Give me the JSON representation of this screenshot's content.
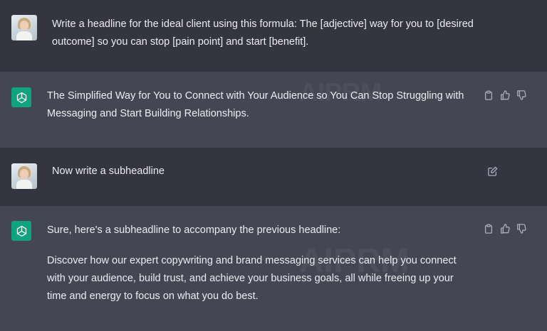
{
  "conversation": [
    {
      "role": "user",
      "avatar_icon": "user-avatar-photo",
      "text_lines": [
        "Write a headline for the ideal client using this formula: The [adjective] way for you to [desired",
        "outcome] so you can stop [pain point] and start [benefit]."
      ]
    },
    {
      "role": "assistant",
      "avatar_icon": "chatgpt-logo-icon",
      "text_lines": [
        "The Simplified Way for You to Connect with Your Audience so You Can Stop Struggling with",
        "Messaging and Start Building Relationships."
      ]
    },
    {
      "role": "user",
      "avatar_icon": "user-avatar-photo",
      "text_lines": [
        "Now write a subheadline"
      ]
    },
    {
      "role": "assistant",
      "avatar_icon": "chatgpt-logo-icon",
      "intro": "Sure, here's a subheadline to accompany the previous headline:",
      "text_lines": [
        "Discover how our expert copywriting and brand messaging services can help you connect",
        "with your audience, build trust, and achieve your business goals, all while freeing up your",
        "time and energy to focus on what you do best."
      ]
    }
  ],
  "watermark": {
    "text_top": "AIPRM",
    "text_bottom": "AIPRM"
  },
  "colors": {
    "user_bg": "#343541",
    "assistant_bg": "#444654",
    "logo_green": "#10a37f",
    "text": "#ececf1",
    "icon": "#acacbe"
  },
  "icons": [
    "copy-icon",
    "thumbs-up-icon",
    "thumbs-down-icon",
    "edit-icon"
  ]
}
